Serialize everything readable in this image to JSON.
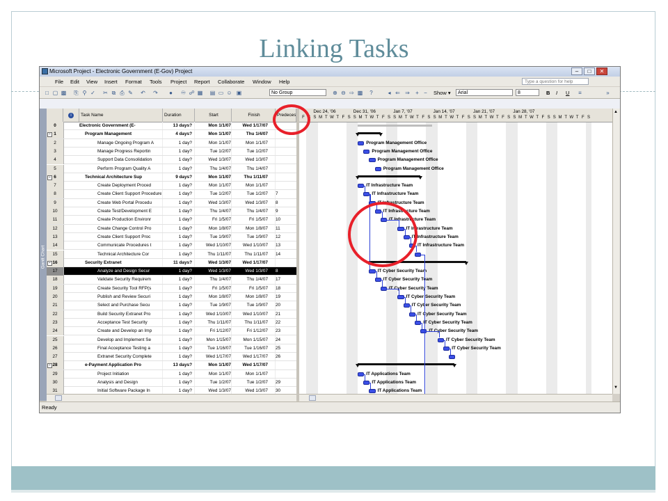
{
  "slide": {
    "title": "Linking Tasks"
  },
  "app": {
    "window_title": "Microsoft Project - Electronic Government (E-Gov) Project",
    "menus": [
      "File",
      "Edit",
      "View",
      "Insert",
      "Format",
      "Tools",
      "Project",
      "Report",
      "Collaborate",
      "Window",
      "Help"
    ],
    "help_placeholder": "Type a question for help",
    "toolbar": {
      "group": "No Group",
      "show": "Show ▾",
      "font": "Arial",
      "size": "8",
      "bold": "B",
      "italic": "I",
      "underline": "U"
    },
    "status": "Ready",
    "view_label": "Gantt Chart"
  },
  "grid": {
    "headers": {
      "task_name": "Task Name",
      "duration": "Duration",
      "start": "Start",
      "finish": "Finish",
      "pred": "Predeces"
    },
    "rows": [
      {
        "id": "0",
        "name": "Electronic Government (E-",
        "dur": "13 days?",
        "start": "Mon 1/1/07",
        "finish": "Wed 1/17/07",
        "pred": ""
      },
      {
        "id": "1",
        "name": "Program Management",
        "dur": "4 days?",
        "start": "Mon 1/1/07",
        "finish": "Thu 1/4/07",
        "pred": ""
      },
      {
        "id": "2",
        "name": "Manage Ongoing Program A",
        "dur": "1 day?",
        "start": "Mon 1/1/07",
        "finish": "Mon 1/1/07",
        "pred": ""
      },
      {
        "id": "3",
        "name": "Manage Progress Reportin",
        "dur": "1 day?",
        "start": "Tue 1/2/07",
        "finish": "Tue 1/2/07",
        "pred": ""
      },
      {
        "id": "4",
        "name": "Support Data Consolidation",
        "dur": "1 day?",
        "start": "Wed 1/3/07",
        "finish": "Wed 1/3/07",
        "pred": ""
      },
      {
        "id": "5",
        "name": "Perform Program Quality A",
        "dur": "1 day?",
        "start": "Thu 1/4/07",
        "finish": "Thu 1/4/07",
        "pred": ""
      },
      {
        "id": "6",
        "name": "Technical Architecture Sup",
        "dur": "9 days?",
        "start": "Mon 1/1/07",
        "finish": "Thu 1/11/07",
        "pred": ""
      },
      {
        "id": "7",
        "name": "Create Deployment Proced",
        "dur": "1 day?",
        "start": "Mon 1/1/07",
        "finish": "Mon 1/1/07",
        "pred": ""
      },
      {
        "id": "8",
        "name": "Create Client Support Procedure",
        "dur": "1 day?",
        "start": "Tue 1/2/07",
        "finish": "Tue 1/2/07",
        "pred": "7"
      },
      {
        "id": "9",
        "name": "Create Web Portal Procedu",
        "dur": "1 day?",
        "start": "Wed 1/3/07",
        "finish": "Wed 1/3/07",
        "pred": "8"
      },
      {
        "id": "10",
        "name": "Create Test/Development E",
        "dur": "1 day?",
        "start": "Thu 1/4/07",
        "finish": "Thu 1/4/07",
        "pred": "9"
      },
      {
        "id": "11",
        "name": "Create Production Environr",
        "dur": "1 day?",
        "start": "Fri 1/5/07",
        "finish": "Fri 1/5/07",
        "pred": "10"
      },
      {
        "id": "12",
        "name": "Create Change Control Pro",
        "dur": "1 day?",
        "start": "Mon 1/8/07",
        "finish": "Mon 1/8/07",
        "pred": "11"
      },
      {
        "id": "13",
        "name": "Create Client Support Proc",
        "dur": "1 day?",
        "start": "Tue 1/9/07",
        "finish": "Tue 1/9/07",
        "pred": "12"
      },
      {
        "id": "14",
        "name": "Communicate Procedures t",
        "dur": "1 day?",
        "start": "Wed 1/10/07",
        "finish": "Wed 1/10/07",
        "pred": "13"
      },
      {
        "id": "15",
        "name": "Technical Architecture Cor",
        "dur": "1 day?",
        "start": "Thu 1/11/07",
        "finish": "Thu 1/11/07",
        "pred": "14"
      },
      {
        "id": "16",
        "name": "Security Extranet",
        "dur": "11 days?",
        "start": "Wed 1/3/07",
        "finish": "Wed 1/17/07",
        "pred": ""
      },
      {
        "id": "17",
        "name": "Analyze and Design Secur",
        "dur": "1 day?",
        "start": "Wed 1/3/07",
        "finish": "Wed 1/3/07",
        "pred": "8"
      },
      {
        "id": "18",
        "name": "Validate Security Requirem",
        "dur": "1 day?",
        "start": "Thu 1/4/07",
        "finish": "Thu 1/4/07",
        "pred": "17"
      },
      {
        "id": "19",
        "name": "Create Security Tool RFP(s",
        "dur": "1 day?",
        "start": "Fri 1/5/07",
        "finish": "Fri 1/5/07",
        "pred": "18"
      },
      {
        "id": "20",
        "name": "Publish and Review Securi",
        "dur": "1 day?",
        "start": "Mon 1/8/07",
        "finish": "Mon 1/8/07",
        "pred": "19"
      },
      {
        "id": "21",
        "name": "Select and Purchase Secu",
        "dur": "1 day?",
        "start": "Tue 1/9/07",
        "finish": "Tue 1/9/07",
        "pred": "20"
      },
      {
        "id": "22",
        "name": "Build Security Extranet Pro",
        "dur": "1 day?",
        "start": "Wed 1/10/07",
        "finish": "Wed 1/10/07",
        "pred": "21"
      },
      {
        "id": "23",
        "name": "Acceptance Test Security",
        "dur": "1 day?",
        "start": "Thu 1/11/07",
        "finish": "Thu 1/11/07",
        "pred": "22"
      },
      {
        "id": "24",
        "name": "Create and Develop an Imp",
        "dur": "1 day?",
        "start": "Fri 1/12/07",
        "finish": "Fri 1/12/07",
        "pred": "23"
      },
      {
        "id": "25",
        "name": "Develop and Implement Se",
        "dur": "1 day?",
        "start": "Mon 1/15/07",
        "finish": "Mon 1/15/07",
        "pred": "24"
      },
      {
        "id": "26",
        "name": "Final Acceptance Testing a",
        "dur": "1 day?",
        "start": "Tue 1/16/07",
        "finish": "Tue 1/16/07",
        "pred": "25"
      },
      {
        "id": "27",
        "name": "Extranet Security Complete",
        "dur": "1 day?",
        "start": "Wed 1/17/07",
        "finish": "Wed 1/17/07",
        "pred": "26"
      },
      {
        "id": "28",
        "name": "e-Payment Application Pro",
        "dur": "13 days?",
        "start": "Mon 1/1/07",
        "finish": "Wed 1/17/07",
        "pred": ""
      },
      {
        "id": "29",
        "name": "Project Initiation",
        "dur": "1 day?",
        "start": "Mon 1/1/07",
        "finish": "Mon 1/1/07",
        "pred": ""
      },
      {
        "id": "30",
        "name": "Analysis and Design",
        "dur": "1 day?",
        "start": "Tue 1/2/07",
        "finish": "Tue 1/2/07",
        "pred": "29"
      },
      {
        "id": "31",
        "name": "Initial Software Package In",
        "dur": "1 day?",
        "start": "Wed 1/3/07",
        "finish": "Wed 1/3/07",
        "pred": "30"
      }
    ]
  },
  "gantt": {
    "weeks": [
      "Dec 24, '06",
      "Dec 31, '06",
      "Jan 7, '07",
      "Jan 14, '07",
      "Jan 21, '07",
      "Jan 28, '07"
    ],
    "day_letters": [
      "F",
      "S",
      "S",
      "M",
      "T",
      "W",
      "T",
      "F",
      "S",
      "S",
      "M",
      "T",
      "W",
      "T",
      "F",
      "S",
      "S",
      "M",
      "T",
      "W",
      "T",
      "F",
      "S",
      "S",
      "M",
      "T",
      "W",
      "T",
      "F",
      "S",
      "S",
      "M",
      "T",
      "W",
      "T",
      "F",
      "S",
      "S",
      "M",
      "T",
      "W",
      "T",
      "F",
      "S",
      "S",
      "M",
      "T",
      "W",
      "T",
      "F",
      "S"
    ],
    "tasks": [
      {
        "row": 0,
        "day": 10,
        "len": 13,
        "kind": "project",
        "label": ""
      },
      {
        "row": 1,
        "day": 10,
        "len": 4,
        "kind": "summary",
        "label": ""
      },
      {
        "row": 2,
        "day": 10,
        "len": 1,
        "kind": "task",
        "label": "Program Management Office"
      },
      {
        "row": 3,
        "day": 11,
        "len": 1,
        "kind": "task",
        "label": "Program Management Office"
      },
      {
        "row": 4,
        "day": 12,
        "len": 1,
        "kind": "task",
        "label": "Program Management Office"
      },
      {
        "row": 5,
        "day": 13,
        "len": 1,
        "kind": "task",
        "label": "Program Management Office"
      },
      {
        "row": 6,
        "day": 10,
        "len": 11,
        "kind": "summary",
        "label": ""
      },
      {
        "row": 7,
        "day": 10,
        "len": 1,
        "kind": "task",
        "label": "IT Infrastructure Team"
      },
      {
        "row": 8,
        "day": 11,
        "len": 1,
        "kind": "task",
        "label": "IT Infrastructure Team"
      },
      {
        "row": 9,
        "day": 12,
        "len": 1,
        "kind": "task",
        "label": "IT Infrastructure Team"
      },
      {
        "row": 10,
        "day": 13,
        "len": 1,
        "kind": "task",
        "label": "IT Infrastructure Team"
      },
      {
        "row": 11,
        "day": 14,
        "len": 1,
        "kind": "task",
        "label": "IT Infrastructure Team"
      },
      {
        "row": 12,
        "day": 17,
        "len": 1,
        "kind": "task",
        "label": "IT Infrastructure Team"
      },
      {
        "row": 13,
        "day": 18,
        "len": 1,
        "kind": "task",
        "label": "IT Infrastructure Team"
      },
      {
        "row": 14,
        "day": 19,
        "len": 1,
        "kind": "task",
        "label": "IT Infrastructure Team"
      },
      {
        "row": 15,
        "day": 20,
        "len": 1,
        "kind": "task",
        "label": ""
      },
      {
        "row": 16,
        "day": 12,
        "len": 17,
        "kind": "summary",
        "label": ""
      },
      {
        "row": 17,
        "day": 12,
        "len": 1,
        "kind": "task",
        "label": "IT Cyber Security Team"
      },
      {
        "row": 18,
        "day": 13,
        "len": 1,
        "kind": "task",
        "label": "IT Cyber Security Team"
      },
      {
        "row": 19,
        "day": 14,
        "len": 1,
        "kind": "task",
        "label": "IT Cyber Security Team"
      },
      {
        "row": 20,
        "day": 17,
        "len": 1,
        "kind": "task",
        "label": "IT Cyber Security Team"
      },
      {
        "row": 21,
        "day": 18,
        "len": 1,
        "kind": "task",
        "label": "IT Cyber Security Team"
      },
      {
        "row": 22,
        "day": 19,
        "len": 1,
        "kind": "task",
        "label": "IT Cyber Security Team"
      },
      {
        "row": 23,
        "day": 20,
        "len": 1,
        "kind": "task",
        "label": "IT Cyber Security Team"
      },
      {
        "row": 24,
        "day": 21,
        "len": 1,
        "kind": "task",
        "label": "IT Cyber Security Team"
      },
      {
        "row": 25,
        "day": 24,
        "len": 1,
        "kind": "task",
        "label": "IT Cyber Security Team"
      },
      {
        "row": 26,
        "day": 25,
        "len": 1,
        "kind": "task",
        "label": "IT Cyber Security Team"
      },
      {
        "row": 27,
        "day": 26,
        "len": 1,
        "kind": "task",
        "label": ""
      },
      {
        "row": 28,
        "day": 10,
        "len": 17,
        "kind": "summary",
        "label": ""
      },
      {
        "row": 29,
        "day": 10,
        "len": 1,
        "kind": "task",
        "label": "IT Applications Team"
      },
      {
        "row": 30,
        "day": 11,
        "len": 1,
        "kind": "task",
        "label": "IT Applications Team"
      },
      {
        "row": 31,
        "day": 12,
        "len": 1,
        "kind": "task",
        "label": "IT Applications Team"
      }
    ]
  }
}
